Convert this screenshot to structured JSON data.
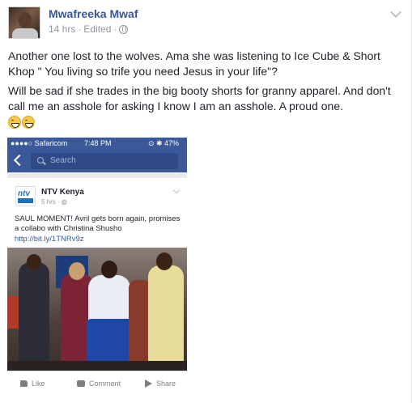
{
  "post": {
    "author": "Mwafreeka Mwaf",
    "time": "14 hrs",
    "edited": "Edited",
    "separator": "·",
    "text_line1": "Another one lost to the wolves. Ama she was listening to Ice Cube & Short Khop \" You living so trife you need Jesus in your life\"?",
    "text_line2": "Will be sad if she trades in the big booty shorts for granny apparel. And don't call me an asshole for asking I know I am an asshole. A proud one."
  },
  "phone": {
    "carrier": "●●●●○ Safaricom",
    "time": "7:48 PM",
    "battery": "47%",
    "search_placeholder": "Search"
  },
  "shared_post": {
    "logo_text": "ntv",
    "page_name": "NTV Kenya",
    "meta": "5 hrs · ",
    "text": "SAUL MOMENT! Avril gets born again, promises a collabo with Christina Shusho",
    "link": "http://bit.ly/1TNRv9z",
    "actions": {
      "like": "Like",
      "comment": "Comment",
      "share": "Share"
    }
  }
}
